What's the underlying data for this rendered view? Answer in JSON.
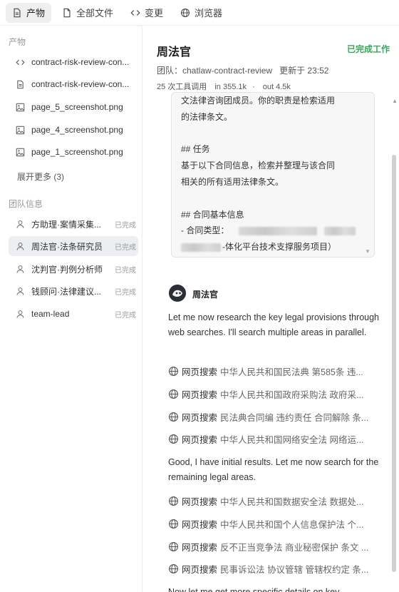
{
  "tabs": [
    {
      "label": "产物",
      "icon": "file-icon"
    },
    {
      "label": "全部文件",
      "icon": "file-icon"
    },
    {
      "label": "变更",
      "icon": "code-icon"
    },
    {
      "label": "浏览器",
      "icon": "globe-icon"
    }
  ],
  "sidebar": {
    "artifacts_title": "产物",
    "files": [
      {
        "name": "contract-risk-review-con...",
        "icon": "code-icon"
      },
      {
        "name": "contract-risk-review-con...",
        "icon": "file-icon"
      },
      {
        "name": "page_5_screenshot.png",
        "icon": "image-icon"
      },
      {
        "name": "page_4_screenshot.png",
        "icon": "image-icon"
      },
      {
        "name": "page_1_screenshot.png",
        "icon": "image-icon"
      }
    ],
    "expand_label": "展开更多 (3)",
    "team_title": "团队信息",
    "members": [
      {
        "name": "方助理·案情采集...",
        "status": "已完成"
      },
      {
        "name": "周法官·法条研究员",
        "status": "已完成"
      },
      {
        "name": "沈判官·判例分析师",
        "status": "已完成"
      },
      {
        "name": "钱顾问·法律建议...",
        "status": "已完成"
      },
      {
        "name": "team-lead",
        "status": "已完成"
      }
    ]
  },
  "main": {
    "title": "周法官",
    "status": "已完成工作",
    "team_line": "团队：chatlaw-contract-review",
    "updated_line": "更新于 23:52",
    "tool_calls": "25 次工具调用",
    "tokens_in": "in 355.1k",
    "tokens_out": "out 4.5k",
    "prompt": {
      "line1": "文法律咨询团成员。你的职责是检索适用",
      "line2": "的法律条文。",
      "line3": "## 任务",
      "line4": "基于以下合同信息，检索并整理与该合同",
      "line5": "相关的所有适用法律条文。",
      "line6": "## 合同基本信息",
      "line7": "- 合同类型：",
      "line8": "-体化平台技术支撑服务项目）"
    },
    "agent_name": "周法官",
    "para1": "Let me now research the key legal provisions through web searches. I'll search multiple areas in parallel.",
    "search_label": "网页搜索",
    "searches1": [
      "中华人民共和国民法典 第585条 违...",
      "中华人民共和国政府采购法 政府采...",
      "民法典合同编 违约责任 合同解除 条...",
      "中华人民共和国网络安全法 网络运..."
    ],
    "para2": "Good, I have initial results. Let me now search for the remaining legal areas.",
    "searches2": [
      "中华人民共和国数据安全法 数据处...",
      "中华人民共和国个人信息保护法 个...",
      "反不正当竞争法 商业秘密保护 条文 ...",
      "民事诉讼法 协议管辖 管辖权约定 条..."
    ],
    "para3": "Now let me get more specific details on key"
  }
}
